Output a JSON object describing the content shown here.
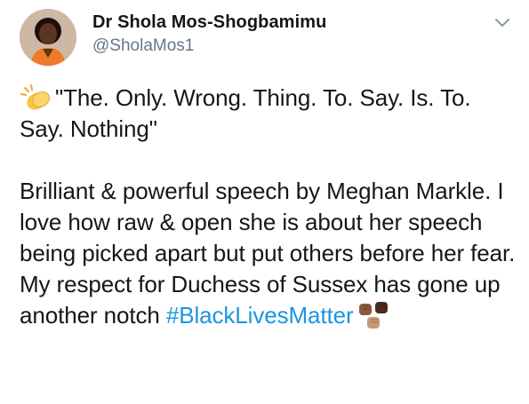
{
  "tweet": {
    "author": {
      "display_name": "Dr Shola Mos-Shogbamimu",
      "handle": "@SholaMos1"
    },
    "text": {
      "quote": "\"The. Only. Wrong. Thing. To. Say. Is. To. Say. Nothing\"",
      "body": "Brilliant & powerful speech by Meghan Markle. I love how raw & open she is about her speech being picked apart but put others before her fear. My respect for Duchess of Sussex has gone up another notch ",
      "hashtag": "#BlackLivesMatter"
    },
    "icons": {
      "menu": "chevron-down-icon",
      "quote_emoji": "clapping-hands-emoji",
      "hashtag_emoji": "raised-fists-emoji"
    },
    "colors": {
      "hashtag": "#1b95e0",
      "handle": "#657786",
      "text": "#14171a"
    }
  }
}
